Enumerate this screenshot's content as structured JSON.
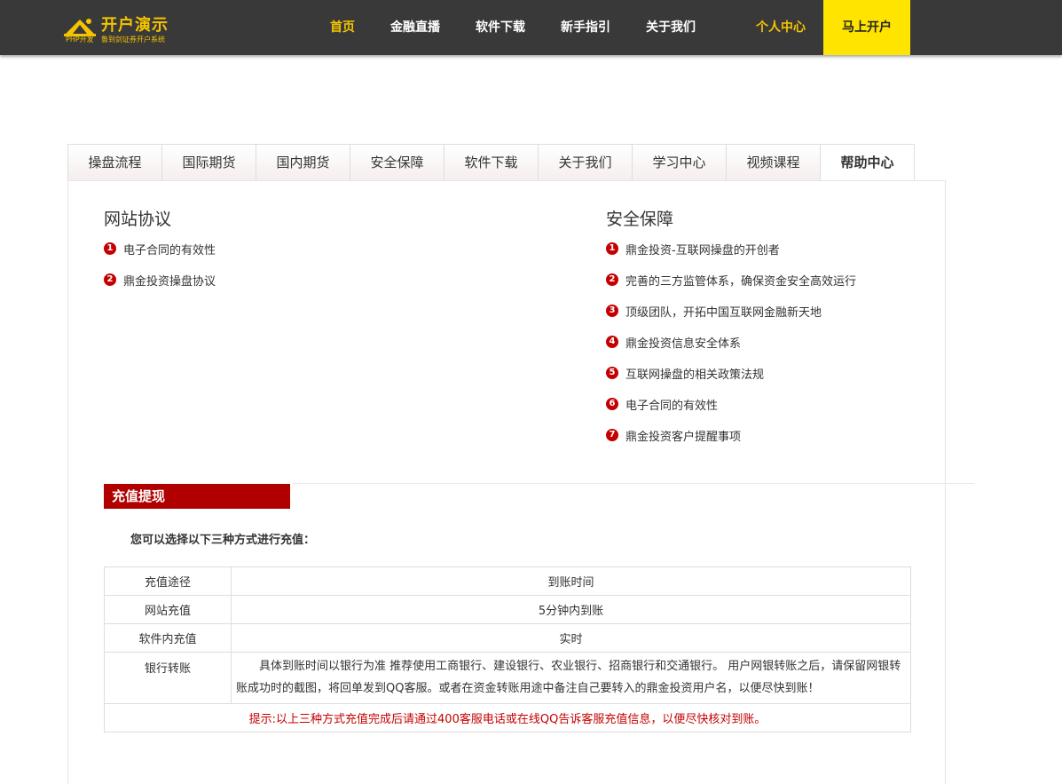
{
  "logo": {
    "title": "开户演示",
    "sub_a": "PHP开发",
    "sub_b": "鲁到剑证券开户系统"
  },
  "nav": {
    "items": [
      {
        "label": "首页",
        "active": true
      },
      {
        "label": "金融直播"
      },
      {
        "label": "软件下载"
      },
      {
        "label": "新手指引"
      },
      {
        "label": "关于我们"
      }
    ],
    "personal": "个人中心",
    "open_account": "马上开户"
  },
  "tabs": [
    {
      "label": "操盘流程"
    },
    {
      "label": "国际期货"
    },
    {
      "label": "国内期货"
    },
    {
      "label": "安全保障"
    },
    {
      "label": "软件下载"
    },
    {
      "label": "关于我们"
    },
    {
      "label": "学习中心"
    },
    {
      "label": "视频课程"
    },
    {
      "label": "帮助中心",
      "active": true
    }
  ],
  "left_col": {
    "title": "网站协议",
    "items": [
      {
        "num": "1",
        "text": "电子合同的有效性"
      },
      {
        "num": "2",
        "text": "鼎金投资操盘协议"
      }
    ]
  },
  "right_col": {
    "title": "安全保障",
    "items": [
      {
        "num": "1",
        "text": "鼎金投资-互联网操盘的开创者"
      },
      {
        "num": "2",
        "text": "完善的三方监管体系，确保资金安全高效运行"
      },
      {
        "num": "3",
        "text": "顶级团队，开拓中国互联网金融新天地"
      },
      {
        "num": "4",
        "text": "鼎金投资信息安全体系"
      },
      {
        "num": "5",
        "text": "互联网操盘的相关政策法规"
      },
      {
        "num": "6",
        "text": "电子合同的有效性"
      },
      {
        "num": "7",
        "text": "鼎金投资客户提醒事项"
      }
    ]
  },
  "recharge": {
    "heading": "充值提现",
    "intro": "您可以选择以下三种方式进行充值：",
    "table": {
      "header": [
        "充值途径",
        "到账时间"
      ],
      "rows": [
        [
          "网站充值",
          "5分钟内到账"
        ],
        [
          "软件内充值",
          "实时"
        ],
        [
          "银行转账",
          "具体到账时间以银行为准 推荐使用工商银行、建设银行、农业银行、招商银行和交通银行。 用户网银转账之后，请保留网银转账成功时的截图，将回单发到QQ客服。或者在资金转账用途中备注自己要转入的鼎金投资用户名，以便尽快到账！"
        ]
      ],
      "tip": "提示:以上三种方式充值完成后请通过400客服电话或在线QQ告诉客服充值信息，以便尽快核对到账。"
    }
  },
  "colors": {
    "topbar": "#393939",
    "accent_yellow": "#ffe400",
    "accent_red": "#b00000"
  }
}
